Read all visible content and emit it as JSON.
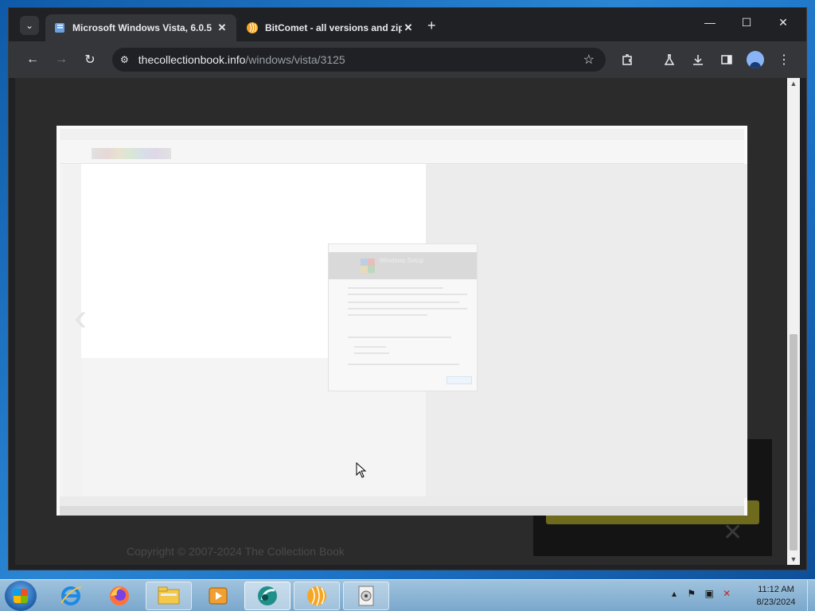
{
  "browser": {
    "tabs": [
      {
        "title": "Microsoft Windows Vista, 6.0.5",
        "active": true,
        "favicon": "book-icon"
      },
      {
        "title": "BitComet - all versions and zip",
        "active": false,
        "favicon": "bitcomet-icon"
      }
    ],
    "new_tab": "+",
    "address": {
      "host": "thecollectionbook.info",
      "path": "/windows/vista/3125"
    },
    "window_controls": {
      "minimize": "—",
      "maximize": "☐",
      "close": "✕"
    }
  },
  "page": {
    "copyright": "Copyright © 2007-2024 The Collection Book",
    "lightbox": {
      "dialog_title": "Windows Setup"
    }
  },
  "taskbar": {
    "items": [
      "internet-explorer",
      "firefox",
      "windows-explorer",
      "media-player",
      "bitcomet-app",
      "bitcomet-orange",
      "installer"
    ],
    "clock": {
      "time": "11:12 AM",
      "date": "8/23/2024"
    }
  },
  "colors": {
    "chrome_bg": "#202124",
    "toolbar_bg": "#35363a",
    "taskbar": "#8ab4d6"
  }
}
